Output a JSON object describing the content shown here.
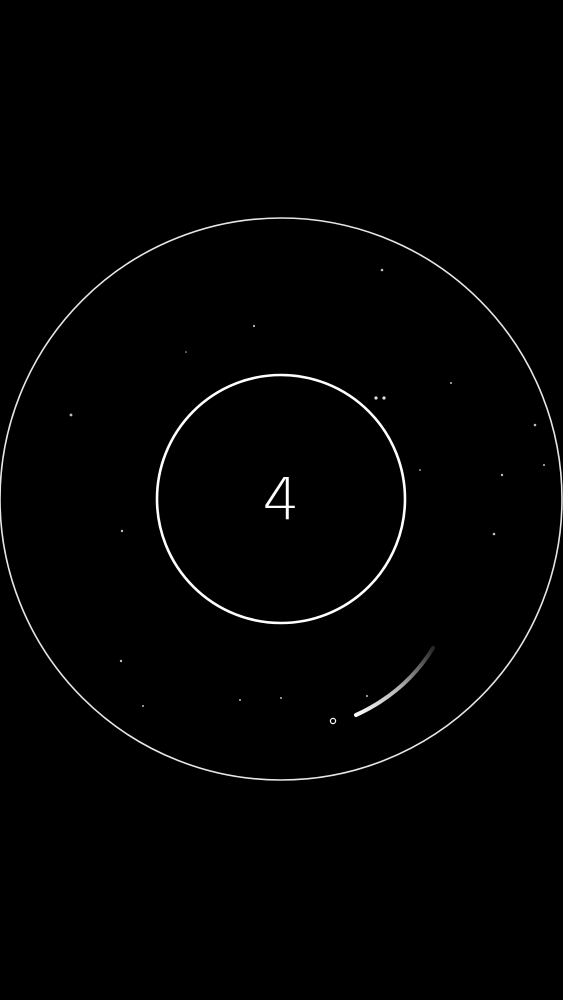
{
  "game": {
    "score": "4"
  },
  "colors": {
    "background": "#000000",
    "ring": "#ffffff",
    "trail": "#f2f2f2",
    "dust": "#9a9a9a"
  }
}
